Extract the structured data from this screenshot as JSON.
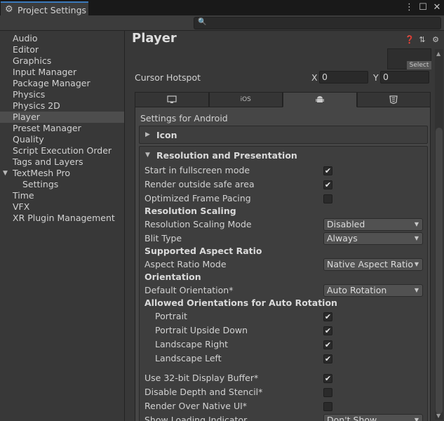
{
  "window": {
    "tab_title": "Project Settings",
    "controls": [
      "⋮",
      "☐",
      "✕"
    ]
  },
  "search": {
    "value": "",
    "placeholder": ""
  },
  "sidebar": {
    "items": [
      {
        "label": "Audio"
      },
      {
        "label": "Editor"
      },
      {
        "label": "Graphics"
      },
      {
        "label": "Input Manager"
      },
      {
        "label": "Package Manager"
      },
      {
        "label": "Physics"
      },
      {
        "label": "Physics 2D"
      },
      {
        "label": "Player",
        "selected": true
      },
      {
        "label": "Preset Manager"
      },
      {
        "label": "Quality"
      },
      {
        "label": "Script Execution Order"
      },
      {
        "label": "Tags and Layers"
      },
      {
        "label": "TextMesh Pro",
        "expanded": true
      },
      {
        "label": "Settings",
        "child": true
      },
      {
        "label": "Time"
      },
      {
        "label": "VFX"
      },
      {
        "label": "XR Plugin Management"
      }
    ]
  },
  "main": {
    "title": "Player",
    "header_icons": [
      "help-icon",
      "preset-icon",
      "gear-icon"
    ],
    "select_label": "Select",
    "cursor_hotspot": {
      "label": "Cursor Hotspot",
      "x_label": "X",
      "x_value": "0",
      "y_label": "Y",
      "y_value": "0"
    },
    "platform_tabs": [
      {
        "name": "standalone",
        "icon": "monitor-icon",
        "label": ""
      },
      {
        "name": "ios",
        "icon": "",
        "label": "iOS"
      },
      {
        "name": "android",
        "icon": "android-icon",
        "label": "",
        "active": true
      },
      {
        "name": "webgl",
        "icon": "html5-icon",
        "label": ""
      }
    ],
    "settings_for": "Settings for Android",
    "icon_section": {
      "title": "Icon",
      "expanded": false
    },
    "resolution_section": {
      "title": "Resolution and Presentation",
      "expanded": true,
      "start_fullscreen": {
        "label": "Start in fullscreen mode",
        "checked": true
      },
      "render_outside_safe": {
        "label": "Render outside safe area",
        "checked": true
      },
      "optimized_frame_pacing": {
        "label": "Optimized Frame Pacing",
        "checked": false
      },
      "resolution_scaling_header": "Resolution Scaling",
      "resolution_scaling_mode": {
        "label": "Resolution Scaling Mode",
        "value": "Disabled"
      },
      "blit_type": {
        "label": "Blit Type",
        "value": "Always"
      },
      "aspect_header": "Supported Aspect Ratio",
      "aspect_ratio_mode": {
        "label": "Aspect Ratio Mode",
        "value": "Native Aspect Ratio"
      },
      "orientation_header": "Orientation",
      "default_orientation": {
        "label": "Default Orientation*",
        "value": "Auto Rotation"
      },
      "allowed_header": "Allowed Orientations for Auto Rotation",
      "portrait": {
        "label": "Portrait",
        "checked": true
      },
      "portrait_upside_down": {
        "label": "Portrait Upside Down",
        "checked": true
      },
      "landscape_right": {
        "label": "Landscape Right",
        "checked": true
      },
      "landscape_left": {
        "label": "Landscape Left",
        "checked": true
      },
      "use_32bit": {
        "label": "Use 32-bit Display Buffer*",
        "checked": true
      },
      "disable_depth": {
        "label": "Disable Depth and Stencil*",
        "checked": false
      },
      "render_over_native": {
        "label": "Render Over Native UI*",
        "checked": false
      },
      "show_loading": {
        "label": "Show Loading Indicator",
        "value": "Don't Show"
      }
    }
  }
}
